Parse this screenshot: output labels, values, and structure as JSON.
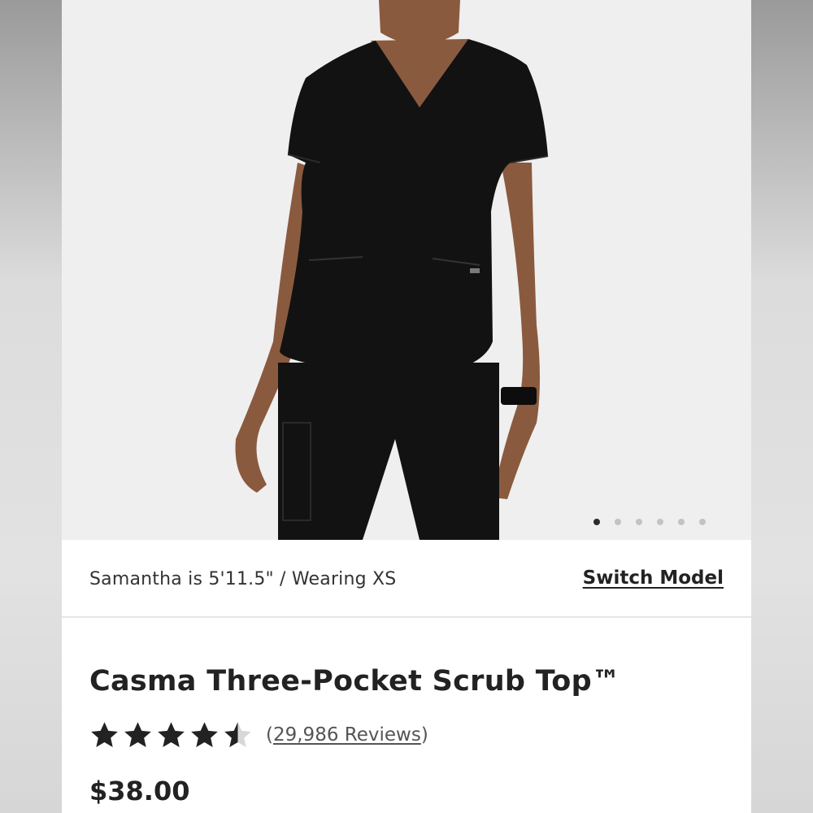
{
  "gallery": {
    "image_alt": "Model wearing black scrub top and pants",
    "dot_count": 6,
    "active_index": 0
  },
  "model_info": {
    "text": "Samantha is 5'11.5\" / Wearing XS",
    "switch_label": "Switch Model"
  },
  "product": {
    "title": "Casma Three-Pocket Scrub Top™",
    "rating": 4.5,
    "rating_max": 5,
    "reviews_open": "(",
    "reviews_label": "29,986 Reviews",
    "reviews_close": ")",
    "price": "$38.00"
  },
  "colors": {
    "garment": "#121212",
    "skin": "#8a5a3f",
    "background": "#efefef",
    "text": "#222222"
  }
}
